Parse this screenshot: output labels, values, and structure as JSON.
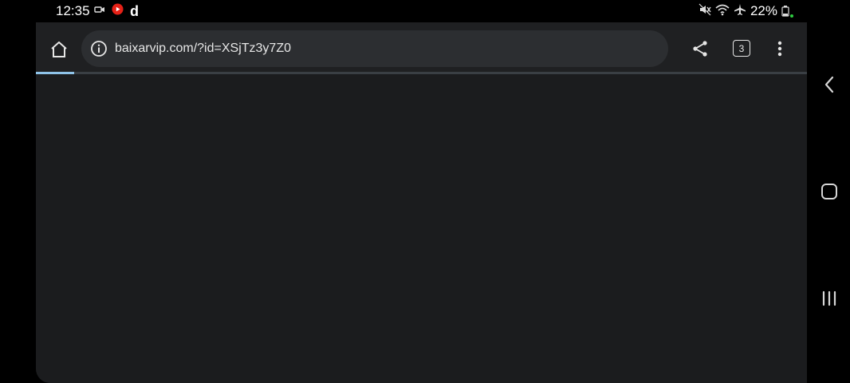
{
  "status_bar": {
    "time": "12:35",
    "battery_percent": "22%",
    "left_icons": [
      "video-camera-icon",
      "youtube-icon",
      "d-app-icon"
    ],
    "d_app_label": "d",
    "right_icons": [
      "mute-icon",
      "wifi-icon",
      "airplane-icon",
      "battery-icon"
    ],
    "youtube_color": "#e62117",
    "dot_color": "#2ecc40"
  },
  "browser": {
    "url": "baixarvip.com/?id=XSjTz3y7Z0",
    "tab_count": "3",
    "load_progress": 0.05,
    "progress_color": "#8fc3e8"
  },
  "nav_bar": {
    "buttons": [
      "back-icon",
      "home-square-icon",
      "recents-icon"
    ]
  }
}
